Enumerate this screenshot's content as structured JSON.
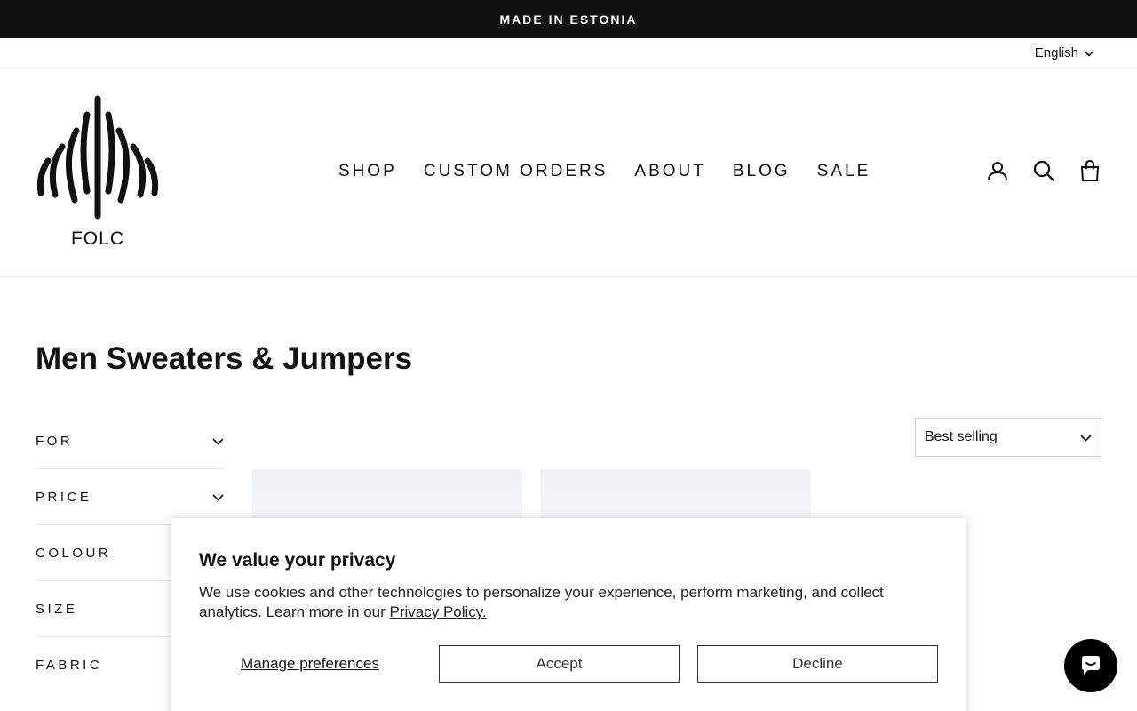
{
  "announcement": "MADE IN ESTONIA",
  "language": {
    "selected": "English"
  },
  "logo": {
    "text": "FOLC"
  },
  "nav": [
    {
      "label": "SHOP"
    },
    {
      "label": "CUSTOM ORDERS"
    },
    {
      "label": "ABOUT"
    },
    {
      "label": "BLOG"
    },
    {
      "label": "SALE"
    }
  ],
  "header_icons": [
    "user-icon",
    "search-icon",
    "cart-icon"
  ],
  "page_title": "Men Sweaters & Jumpers",
  "filters": [
    {
      "label": "FOR"
    },
    {
      "label": "PRICE"
    },
    {
      "label": "COLOUR"
    },
    {
      "label": "SIZE"
    },
    {
      "label": "FABRIC"
    }
  ],
  "sort": {
    "selected": "Best selling"
  },
  "cookie_banner": {
    "title": "We value your privacy",
    "body": "We use cookies and other technologies to personalize your experience, perform marketing, and collect analytics. Learn more in our ",
    "policy_link": "Privacy Policy.",
    "manage_label": "Manage preferences",
    "accept_label": "Accept",
    "decline_label": "Decline"
  },
  "colors": {
    "announcement_bg": "#111111",
    "chat_bg": "#000000",
    "text": "#111111"
  }
}
